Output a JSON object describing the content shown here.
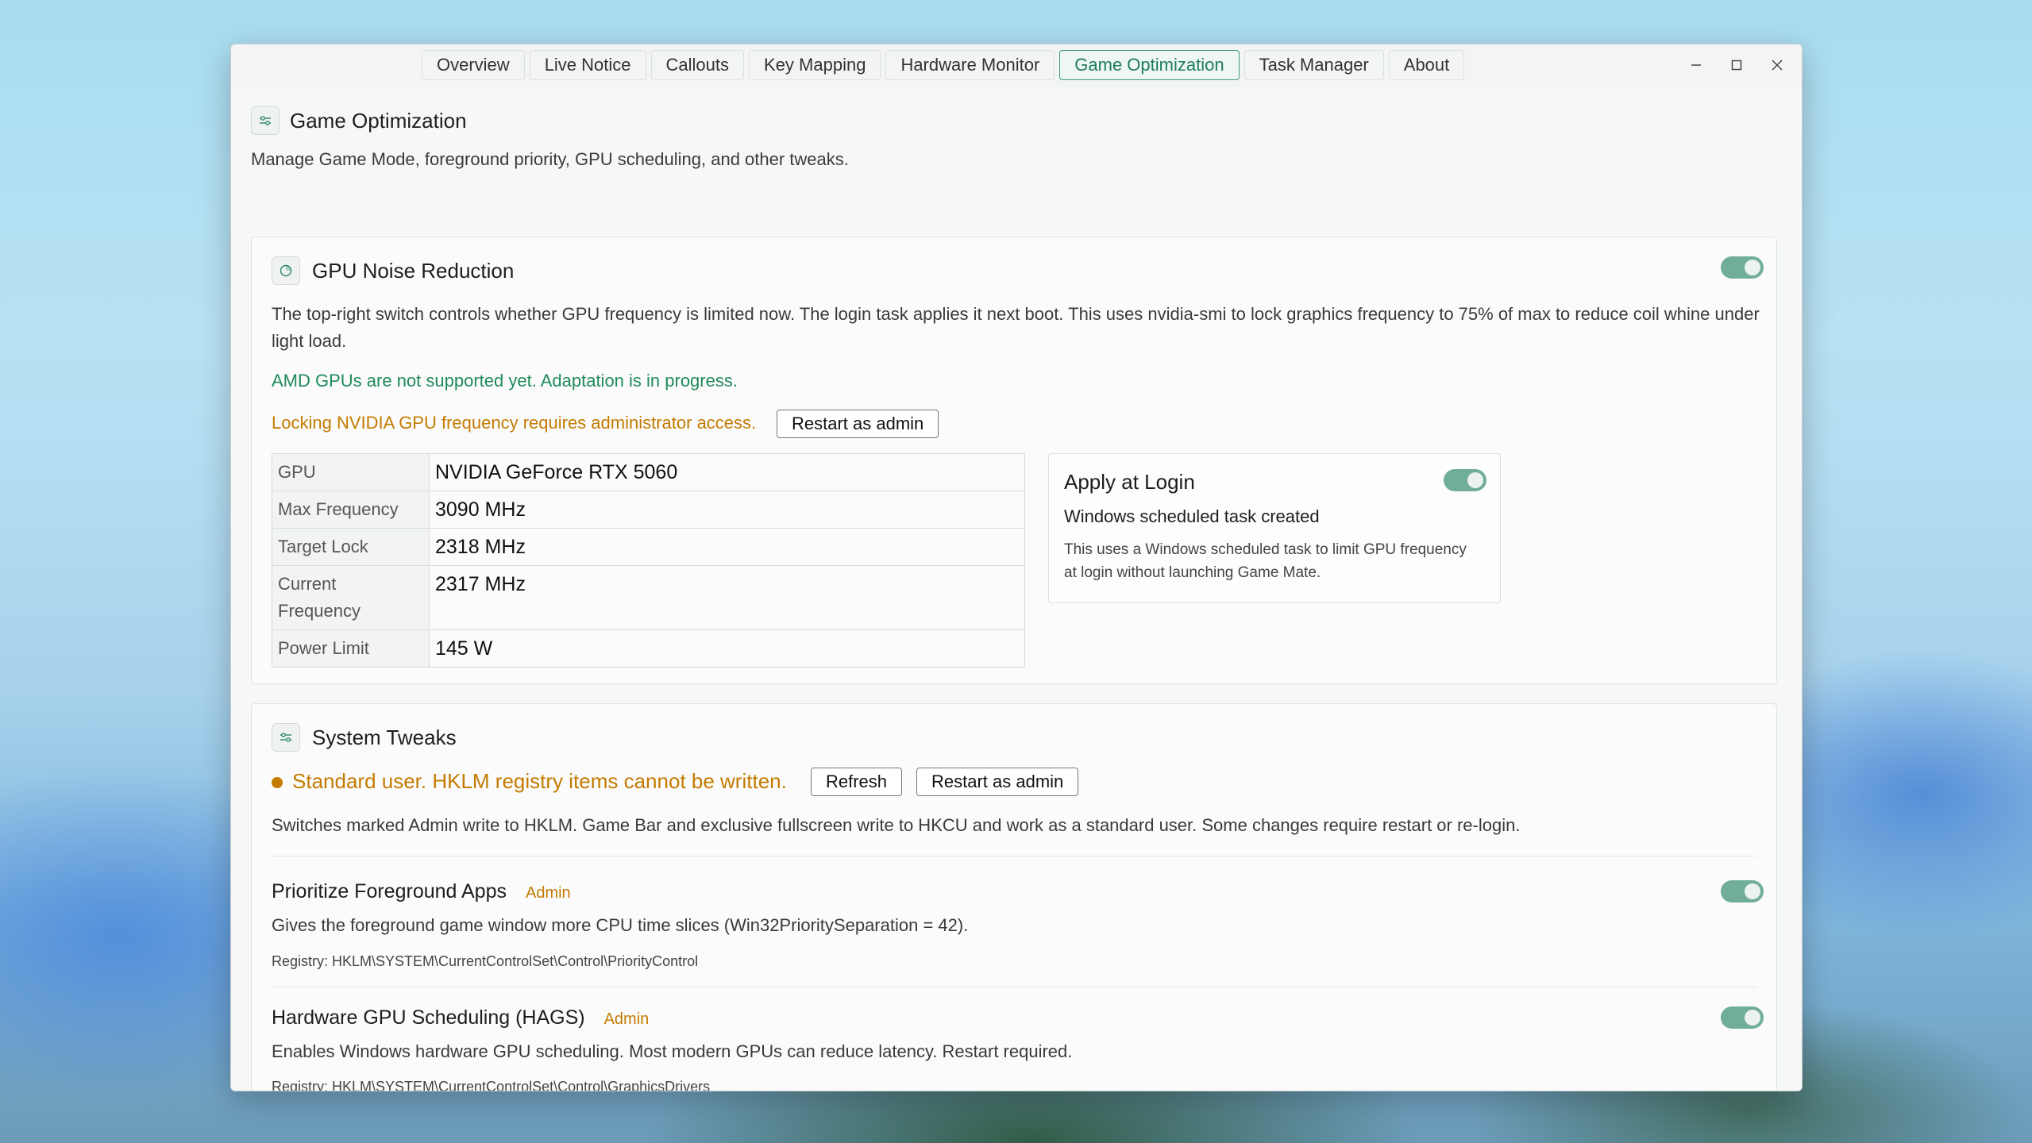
{
  "tabs": [
    {
      "label": "Overview"
    },
    {
      "label": "Live Notice"
    },
    {
      "label": "Callouts"
    },
    {
      "label": "Key Mapping"
    },
    {
      "label": "Hardware Monitor"
    },
    {
      "label": "Game Optimization",
      "active": true
    },
    {
      "label": "Task Manager"
    },
    {
      "label": "About"
    }
  ],
  "window_controls": {
    "minimize": "–",
    "maximize": "□",
    "close": "✕"
  },
  "page": {
    "title": "Game Optimization",
    "subtitle": "Manage Game Mode, foreground priority, GPU scheduling, and other tweaks."
  },
  "gpu_noise": {
    "title": "GPU Noise Reduction",
    "enabled": true,
    "description": "The top-right switch controls whether GPU frequency is limited now. The login task applies it next boot. This uses nvidia-smi to lock graphics frequency to 75% of max to reduce coil whine under light load.",
    "amd_notice": "AMD GPUs are not supported yet. Adaptation is in progress.",
    "admin_warning": "Locking NVIDIA GPU frequency requires administrator access.",
    "restart_button": "Restart as admin",
    "info": [
      {
        "key": "GPU",
        "value": "NVIDIA GeForce RTX 5060"
      },
      {
        "key": "Max Frequency",
        "value": "3090 MHz"
      },
      {
        "key": "Target Lock",
        "value": "2318 MHz"
      },
      {
        "key": "Current Frequency",
        "value": "2317 MHz"
      },
      {
        "key": "Power Limit",
        "value": "145 W"
      }
    ],
    "login": {
      "title": "Apply at Login",
      "enabled": true,
      "status": "Windows scheduled task created",
      "description": "This uses a Windows scheduled task to limit GPU frequency at login without launching Game Mate."
    }
  },
  "system_tweaks": {
    "title": "System Tweaks",
    "status": "Standard user. HKLM registry items cannot be written.",
    "refresh_button": "Refresh",
    "restart_button": "Restart as admin",
    "description": "Switches marked Admin write to HKLM. Game Bar and exclusive fullscreen write to HKCU and work as a standard user. Some changes require restart or re-login.",
    "items": [
      {
        "title": "Prioritize Foreground Apps",
        "badge": "Admin",
        "enabled": true,
        "description": "Gives the foreground game window more CPU time slices (Win32PrioritySeparation = 42).",
        "registry": "Registry: HKLM\\SYSTEM\\CurrentControlSet\\Control\\PriorityControl"
      },
      {
        "title": "Hardware GPU Scheduling (HAGS)",
        "badge": "Admin",
        "enabled": true,
        "description": "Enables Windows hardware GPU scheduling. Most modern GPUs can reduce latency. Restart required.",
        "registry": "Registry: HKLM\\SYSTEM\\CurrentControlSet\\Control\\GraphicsDrivers"
      }
    ]
  },
  "colors": {
    "accent": "#1f7c5b",
    "toggle_on": "#70ae97",
    "warning": "#c47b00",
    "success": "#1f8a5a"
  }
}
